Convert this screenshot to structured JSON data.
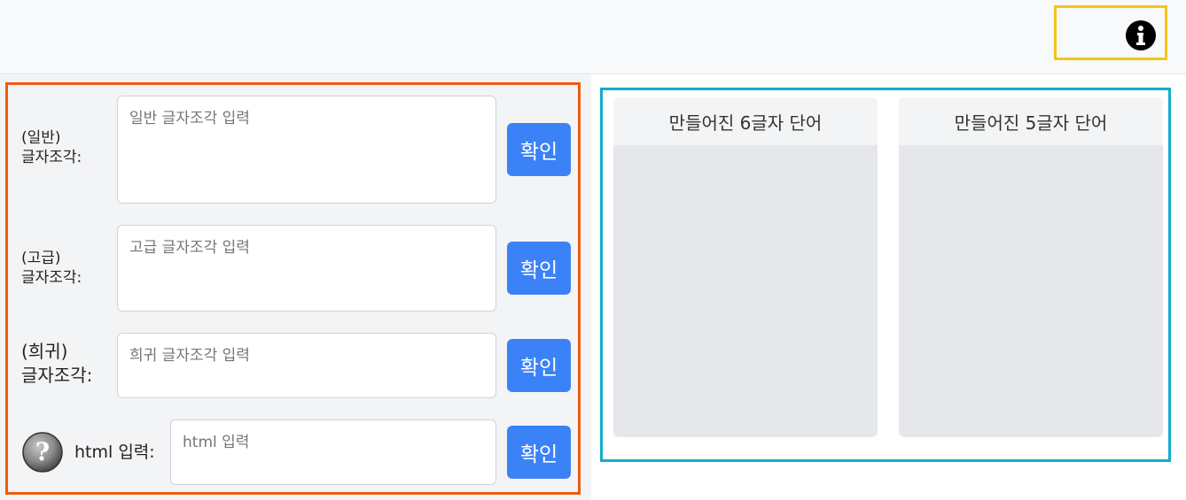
{
  "header": {
    "info_icon": "info-circle-icon"
  },
  "inputs": [
    {
      "label_line1": "(일반)",
      "label_line2": "글자조각:",
      "placeholder": "일반 글자조각 입력",
      "button_label": "확인"
    },
    {
      "label_line1": "(고급)",
      "label_line2": "글자조각:",
      "placeholder": "고급 글자조각 입력",
      "button_label": "확인"
    },
    {
      "label_line1": "(희귀)",
      "label_line2": "글자조각:",
      "placeholder": "희귀 글자조각 입력",
      "button_label": "확인"
    }
  ],
  "html_input": {
    "help_icon": "question-mark-icon",
    "label": "html 입력:",
    "placeholder": "html 입력",
    "button_label": "확인"
  },
  "results": [
    {
      "title": "만들어진 6글자 단어",
      "items": []
    },
    {
      "title": "만들어진 5글자 단어",
      "items": []
    }
  ],
  "colors": {
    "accent": "#3b82f6",
    "left_outline": "#f05a12",
    "right_outline": "#10aecb",
    "info_outline": "#f5c518"
  }
}
